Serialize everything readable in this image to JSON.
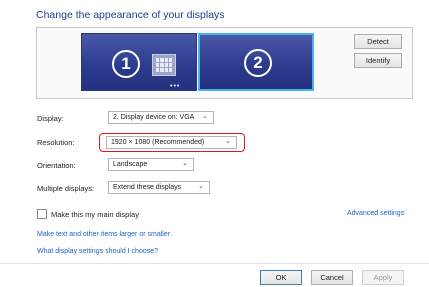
{
  "heading": "Change the appearance of your displays",
  "monitors": [
    {
      "number": "1",
      "selected": false
    },
    {
      "number": "2",
      "selected": true
    }
  ],
  "buttons": {
    "detect": "Detect",
    "identify": "Identify"
  },
  "fields": {
    "display_label": "Display:",
    "display_value": "2. Display device on: VGA",
    "resolution_label": "Resolution:",
    "resolution_value": "1920 × 1080 (Recommended)",
    "orientation_label": "Orientation:",
    "orientation_value": "Landscape",
    "multiple_label": "Multiple displays:",
    "multiple_value": "Extend these displays"
  },
  "main_display_checkbox": {
    "label": "Make this my main display",
    "checked": false
  },
  "links": {
    "advanced": "Advanced settings",
    "text_size": "Make text and other items larger or smaller",
    "which_settings": "What display settings should I choose?"
  },
  "footer": {
    "ok": "OK",
    "cancel": "Cancel",
    "apply": "Apply"
  },
  "colors": {
    "heading": "#1e3f8a",
    "link": "#1b63c9",
    "highlight": "#e11c1c",
    "selected_border": "#4ab0ea"
  }
}
